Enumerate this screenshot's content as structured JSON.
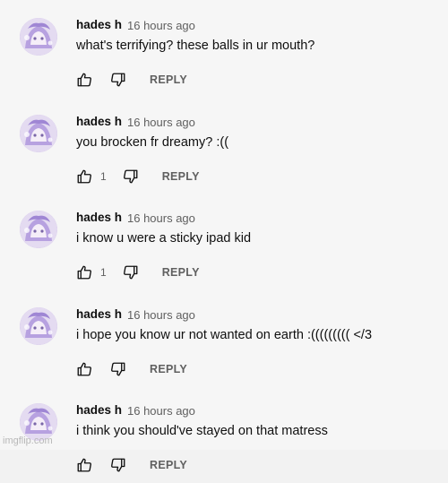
{
  "comments": [
    {
      "author": "hades h",
      "time": "16 hours ago",
      "text": "what's terrifying? these balls in ur mouth?",
      "likes": "",
      "reply_label": "REPLY"
    },
    {
      "author": "hades h",
      "time": "16 hours ago",
      "text": "you brocken fr dreamy? :((",
      "likes": "1",
      "reply_label": "REPLY"
    },
    {
      "author": "hades h",
      "time": "16 hours ago",
      "text": "i know u were a sticky ipad kid",
      "likes": "1",
      "reply_label": "REPLY"
    },
    {
      "author": "hades h",
      "time": "16 hours ago",
      "text": "i hope you know ur not wanted on earth :((((((((( </3",
      "likes": "",
      "reply_label": "REPLY"
    },
    {
      "author": "hades h",
      "time": "16 hours ago",
      "text": "i think you should've stayed on that matress",
      "likes": "",
      "reply_label": "REPLY"
    }
  ],
  "icons": {
    "like": "thumbs-up-icon",
    "dislike": "thumbs-down-icon"
  },
  "watermark": "imgflip.com"
}
